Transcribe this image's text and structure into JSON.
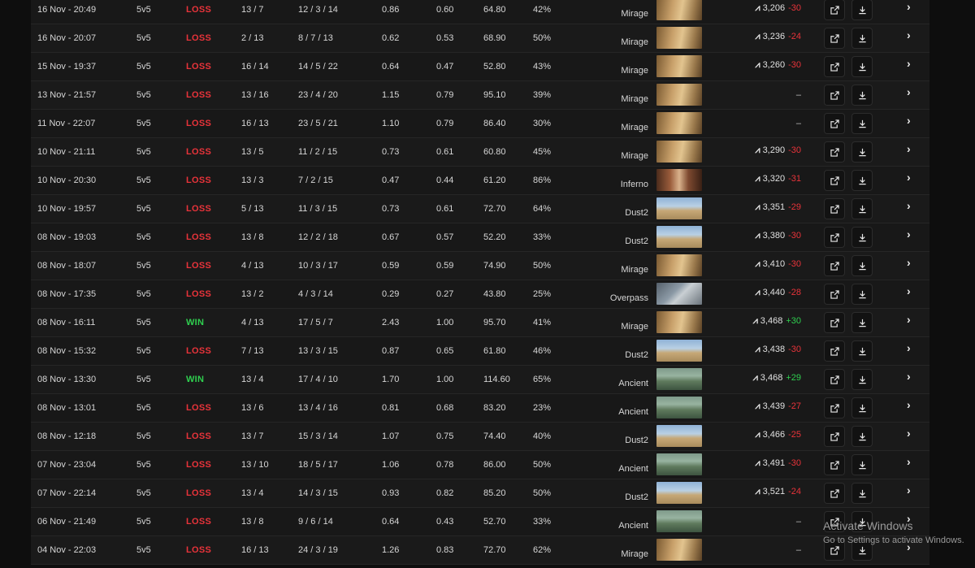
{
  "rows": [
    {
      "date": "16 Nov - 20:49",
      "mode": "5v5",
      "result": "LOSS",
      "score": "13 / 7",
      "kda": "12 / 3 / 14",
      "kd": "0.86",
      "kr": "0.60",
      "adr": "64.80",
      "hs": "42%",
      "map": "Mirage",
      "elo": "3,206",
      "delta": "-30"
    },
    {
      "date": "16 Nov - 20:07",
      "mode": "5v5",
      "result": "LOSS",
      "score": "2 / 13",
      "kda": "8 / 7 / 13",
      "kd": "0.62",
      "kr": "0.53",
      "adr": "68.90",
      "hs": "50%",
      "map": "Mirage",
      "elo": "3,236",
      "delta": "-24"
    },
    {
      "date": "15 Nov - 19:37",
      "mode": "5v5",
      "result": "LOSS",
      "score": "16 / 14",
      "kda": "14 / 5 / 22",
      "kd": "0.64",
      "kr": "0.47",
      "adr": "52.80",
      "hs": "43%",
      "map": "Mirage",
      "elo": "3,260",
      "delta": "-30"
    },
    {
      "date": "13 Nov - 21:57",
      "mode": "5v5",
      "result": "LOSS",
      "score": "13 / 16",
      "kda": "23 / 4 / 20",
      "kd": "1.15",
      "kr": "0.79",
      "adr": "95.10",
      "hs": "39%",
      "map": "Mirage",
      "elo": "",
      "delta": ""
    },
    {
      "date": "11 Nov - 22:07",
      "mode": "5v5",
      "result": "LOSS",
      "score": "16 / 13",
      "kda": "23 / 5 / 21",
      "kd": "1.10",
      "kr": "0.79",
      "adr": "86.40",
      "hs": "30%",
      "map": "Mirage",
      "elo": "",
      "delta": ""
    },
    {
      "date": "10 Nov - 21:11",
      "mode": "5v5",
      "result": "LOSS",
      "score": "13 / 5",
      "kda": "11 / 2 / 15",
      "kd": "0.73",
      "kr": "0.61",
      "adr": "60.80",
      "hs": "45%",
      "map": "Mirage",
      "elo": "3,290",
      "delta": "-30"
    },
    {
      "date": "10 Nov - 20:30",
      "mode": "5v5",
      "result": "LOSS",
      "score": "13 / 3",
      "kda": "7 / 2 / 15",
      "kd": "0.47",
      "kr": "0.44",
      "adr": "61.20",
      "hs": "86%",
      "map": "Inferno",
      "elo": "3,320",
      "delta": "-31"
    },
    {
      "date": "10 Nov - 19:57",
      "mode": "5v5",
      "result": "LOSS",
      "score": "5 / 13",
      "kda": "11 / 3 / 15",
      "kd": "0.73",
      "kr": "0.61",
      "adr": "72.70",
      "hs": "64%",
      "map": "Dust2",
      "elo": "3,351",
      "delta": "-29"
    },
    {
      "date": "08 Nov - 19:03",
      "mode": "5v5",
      "result": "LOSS",
      "score": "13 / 8",
      "kda": "12 / 2 / 18",
      "kd": "0.67",
      "kr": "0.57",
      "adr": "52.20",
      "hs": "33%",
      "map": "Dust2",
      "elo": "3,380",
      "delta": "-30"
    },
    {
      "date": "08 Nov - 18:07",
      "mode": "5v5",
      "result": "LOSS",
      "score": "4 / 13",
      "kda": "10 / 3 / 17",
      "kd": "0.59",
      "kr": "0.59",
      "adr": "74.90",
      "hs": "50%",
      "map": "Mirage",
      "elo": "3,410",
      "delta": "-30"
    },
    {
      "date": "08 Nov - 17:35",
      "mode": "5v5",
      "result": "LOSS",
      "score": "13 / 2",
      "kda": "4 / 3 / 14",
      "kd": "0.29",
      "kr": "0.27",
      "adr": "43.80",
      "hs": "25%",
      "map": "Overpass",
      "elo": "3,440",
      "delta": "-28"
    },
    {
      "date": "08 Nov - 16:11",
      "mode": "5v5",
      "result": "WIN",
      "score": "4 / 13",
      "kda": "17 / 5 / 7",
      "kd": "2.43",
      "kr": "1.00",
      "adr": "95.70",
      "hs": "41%",
      "map": "Mirage",
      "elo": "3,468",
      "delta": "+30"
    },
    {
      "date": "08 Nov - 15:32",
      "mode": "5v5",
      "result": "LOSS",
      "score": "7 / 13",
      "kda": "13 / 3 / 15",
      "kd": "0.87",
      "kr": "0.65",
      "adr": "61.80",
      "hs": "46%",
      "map": "Dust2",
      "elo": "3,438",
      "delta": "-30"
    },
    {
      "date": "08 Nov - 13:30",
      "mode": "5v5",
      "result": "WIN",
      "score": "13 / 4",
      "kda": "17 / 4 / 10",
      "kd": "1.70",
      "kr": "1.00",
      "adr": "114.60",
      "hs": "65%",
      "map": "Ancient",
      "elo": "3,468",
      "delta": "+29"
    },
    {
      "date": "08 Nov - 13:01",
      "mode": "5v5",
      "result": "LOSS",
      "score": "13 / 6",
      "kda": "13 / 4 / 16",
      "kd": "0.81",
      "kr": "0.68",
      "adr": "83.20",
      "hs": "23%",
      "map": "Ancient",
      "elo": "3,439",
      "delta": "-27"
    },
    {
      "date": "08 Nov - 12:18",
      "mode": "5v5",
      "result": "LOSS",
      "score": "13 / 7",
      "kda": "15 / 3 / 14",
      "kd": "1.07",
      "kr": "0.75",
      "adr": "74.40",
      "hs": "40%",
      "map": "Dust2",
      "elo": "3,466",
      "delta": "-25"
    },
    {
      "date": "07 Nov - 23:04",
      "mode": "5v5",
      "result": "LOSS",
      "score": "13 / 10",
      "kda": "18 / 5 / 17",
      "kd": "1.06",
      "kr": "0.78",
      "adr": "86.00",
      "hs": "50%",
      "map": "Ancient",
      "elo": "3,491",
      "delta": "-30"
    },
    {
      "date": "07 Nov - 22:14",
      "mode": "5v5",
      "result": "LOSS",
      "score": "13 / 4",
      "kda": "14 / 3 / 15",
      "kd": "0.93",
      "kr": "0.82",
      "adr": "85.20",
      "hs": "50%",
      "map": "Dust2",
      "elo": "3,521",
      "delta": "-24"
    },
    {
      "date": "06 Nov - 21:49",
      "mode": "5v5",
      "result": "LOSS",
      "score": "13 / 8",
      "kda": "9 / 6 / 14",
      "kd": "0.64",
      "kr": "0.43",
      "adr": "52.70",
      "hs": "33%",
      "map": "Ancient",
      "elo": "",
      "delta": ""
    },
    {
      "date": "04 Nov - 22:03",
      "mode": "5v5",
      "result": "LOSS",
      "score": "16 / 13",
      "kda": "24 / 3 / 19",
      "kd": "1.26",
      "kr": "0.83",
      "adr": "72.70",
      "hs": "62%",
      "map": "Mirage",
      "elo": "",
      "delta": ""
    }
  ],
  "no_elo_text": "–",
  "watermark": {
    "title": "Activate Windows",
    "subtitle": "Go to Settings to activate Windows."
  }
}
